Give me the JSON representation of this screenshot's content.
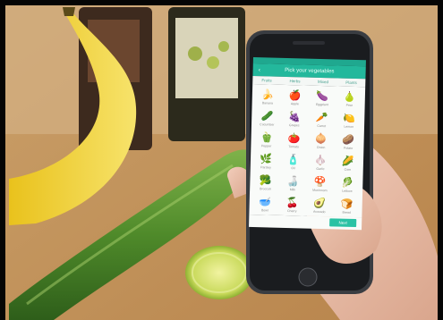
{
  "screen": {
    "title": "Pick your vegetables",
    "back_icon": "back-arrow-icon",
    "tabs": [
      "Fruits",
      "Herbs",
      "Mixed",
      "Plants"
    ],
    "items": [
      {
        "icon": "banana-icon",
        "glyph": "🍌",
        "label": "Banana"
      },
      {
        "icon": "apple-icon",
        "glyph": "🍎",
        "label": "Apple"
      },
      {
        "icon": "eggplant-icon",
        "glyph": "🍆",
        "label": "Eggplant"
      },
      {
        "icon": "pear-icon",
        "glyph": "🍐",
        "label": "Pear"
      },
      {
        "icon": "cucumber-icon",
        "glyph": "🥒",
        "label": "Cucumber"
      },
      {
        "icon": "grapes-icon",
        "glyph": "🍇",
        "label": "Grapes"
      },
      {
        "icon": "carrot-icon",
        "glyph": "🥕",
        "label": "Carrot"
      },
      {
        "icon": "lemon-icon",
        "glyph": "🍋",
        "label": "Lemon"
      },
      {
        "icon": "pepper-icon",
        "glyph": "🫑",
        "label": "Pepper"
      },
      {
        "icon": "tomato-icon",
        "glyph": "🍅",
        "label": "Tomato"
      },
      {
        "icon": "onion-icon",
        "glyph": "🧅",
        "label": "Onion"
      },
      {
        "icon": "potato-icon",
        "glyph": "🥔",
        "label": "Potato"
      },
      {
        "icon": "leaf-icon",
        "glyph": "🌿",
        "label": "Parsley"
      },
      {
        "icon": "bottle-icon",
        "glyph": "🧴",
        "label": "Oil"
      },
      {
        "icon": "garlic-icon",
        "glyph": "🧄",
        "label": "Garlic"
      },
      {
        "icon": "corn-icon",
        "glyph": "🌽",
        "label": "Corn"
      },
      {
        "icon": "broccoli-icon",
        "glyph": "🥦",
        "label": "Broccoli"
      },
      {
        "icon": "bottle-icon",
        "glyph": "🍶",
        "label": "Milk"
      },
      {
        "icon": "mushroom-icon",
        "glyph": "🍄",
        "label": "Mushroom"
      },
      {
        "icon": "lettuce-icon",
        "glyph": "🥬",
        "label": "Lettuce"
      },
      {
        "icon": "bowl-icon",
        "glyph": "🥣",
        "label": "Bowl"
      },
      {
        "icon": "cherry-icon",
        "glyph": "🍒",
        "label": "Cherry"
      },
      {
        "icon": "avocado-icon",
        "glyph": "🥑",
        "label": "Avocado"
      },
      {
        "icon": "bread-icon",
        "glyph": "🍞",
        "label": "Bread"
      }
    ],
    "next_label": "Next"
  }
}
